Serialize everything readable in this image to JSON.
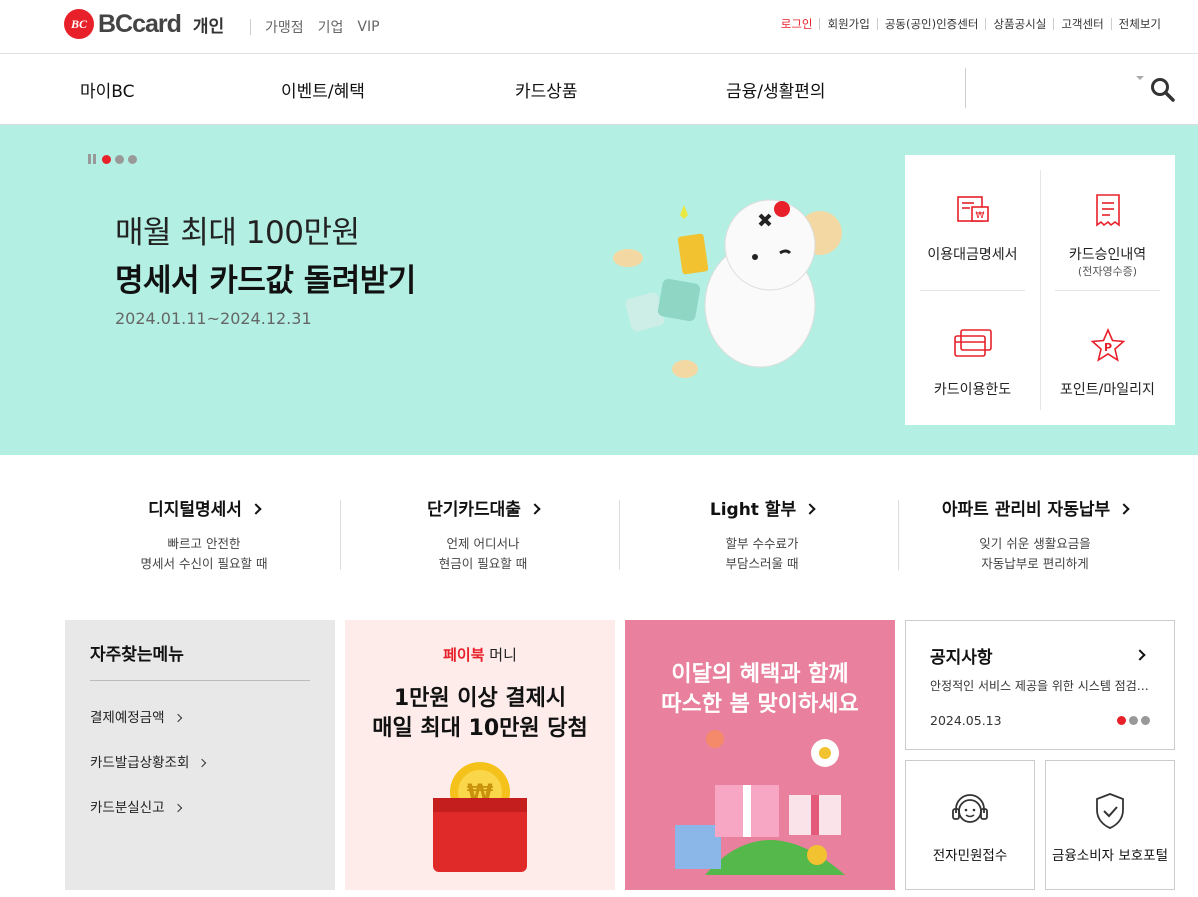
{
  "header": {
    "logo_mark": "BC",
    "logo_text": "BCcard",
    "segment_current": "개인",
    "segments": [
      "가맹점",
      "기업",
      "VIP"
    ],
    "util_links": [
      "로그인",
      "회원가입",
      "공동(공인)인증센터",
      "상품공시실",
      "고객센터",
      "전체보기"
    ]
  },
  "gnb": {
    "items": [
      "마이BC",
      "이벤트/혜택",
      "카드상품",
      "금융/생활편의"
    ]
  },
  "hero": {
    "line1": "매월 최대 100만원",
    "line2": "명세서 카드값 돌려받기",
    "period": "2024.01.11~2024.12.31",
    "slide_count": 3,
    "current_slide": 1
  },
  "quick_menu": [
    {
      "label": "이용대금명세서",
      "sub": "",
      "icon": "statement-icon"
    },
    {
      "label": "카드승인내역",
      "sub": "(전자영수증)",
      "icon": "receipt-icon"
    },
    {
      "label": "카드이용한도",
      "sub": "",
      "icon": "card-limit-icon"
    },
    {
      "label": "포인트/마일리지",
      "sub": "",
      "icon": "point-star-icon"
    }
  ],
  "services": [
    {
      "title": "디지털명세서",
      "desc1": "빠르고 안전한",
      "desc2": "명세서 수신이 필요할 때"
    },
    {
      "title": "단기카드대출",
      "desc1": "언제 어디서나",
      "desc2": "현금이 필요할 때"
    },
    {
      "title": "Light 할부",
      "desc1": "할부 수수료가",
      "desc2": "부담스러울 때"
    },
    {
      "title": "아파트 관리비 자동납부",
      "desc1": "잊기 쉬운 생활요금을",
      "desc2": "자동납부로 편리하게"
    }
  ],
  "frequent": {
    "title": "자주찾는메뉴",
    "items": [
      "결제예정금액",
      "카드발급상황조회",
      "카드분실신고"
    ]
  },
  "promo_paybook": {
    "brand": "페이북",
    "brand_suffix": "머니",
    "line1": "1만원 이상 결제시",
    "line2": "매일 최대 10만원 당첨"
  },
  "promo_spring": {
    "line1": "이달의 혜택과 함께",
    "line2": "따스한 봄 맞이하세요"
  },
  "notice": {
    "title": "공지사항",
    "body": "안정적인 서비스 제공을 위한 시스템 점검 안내",
    "date": "2024.05.13"
  },
  "tiles": [
    {
      "label": "전자민원접수",
      "icon": "headset-icon"
    },
    {
      "label": "금융소비자 보호포털",
      "icon": "shield-check-icon"
    }
  ],
  "colors": {
    "brand_red": "#e8202a",
    "hero_bg": "#b3f0e3",
    "promo_pink": "#e8809e"
  }
}
